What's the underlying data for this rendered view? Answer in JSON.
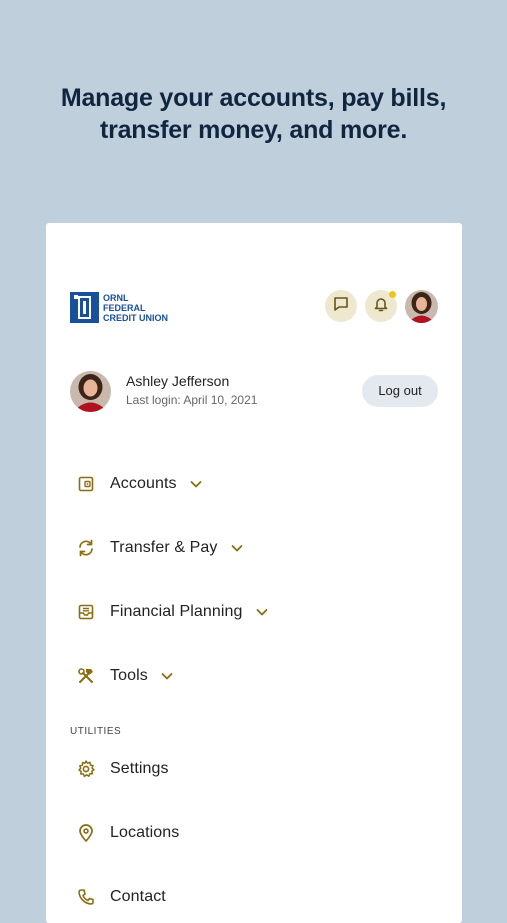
{
  "headline": {
    "line1": "Manage your accounts, pay bills,",
    "line2": "transfer money, and more."
  },
  "logo": {
    "text_line1": "ORNL",
    "text_line2": "FEDERAL",
    "text_line3": "CREDIT UNION",
    "color": "#1a4f9c"
  },
  "header_icons": [
    "chat-icon",
    "bell-icon",
    "avatar"
  ],
  "notification_dot_color": "#f4c21d",
  "user": {
    "name": "Ashley Jefferson",
    "last_login": "Last login: April 10, 2021",
    "logout_label": "Log out"
  },
  "nav": {
    "items": [
      {
        "label": "Accounts",
        "icon": "wallet-icon",
        "expandable": true
      },
      {
        "label": "Transfer & Pay",
        "icon": "transfer-icon",
        "expandable": true
      },
      {
        "label": "Financial Planning",
        "icon": "planning-icon",
        "expandable": true
      },
      {
        "label": "Tools",
        "icon": "tools-icon",
        "expandable": true
      }
    ],
    "utilities_label": "UTILITIES",
    "utilities": [
      {
        "label": "Settings",
        "icon": "gear-icon"
      },
      {
        "label": "Locations",
        "icon": "location-pin-icon"
      },
      {
        "label": "Contact",
        "icon": "phone-icon"
      }
    ]
  },
  "colors": {
    "background": "#bfcfdc",
    "headline": "#10263f",
    "icon_gold": "#8a6d13",
    "icon_bg": "#ede8cf"
  }
}
